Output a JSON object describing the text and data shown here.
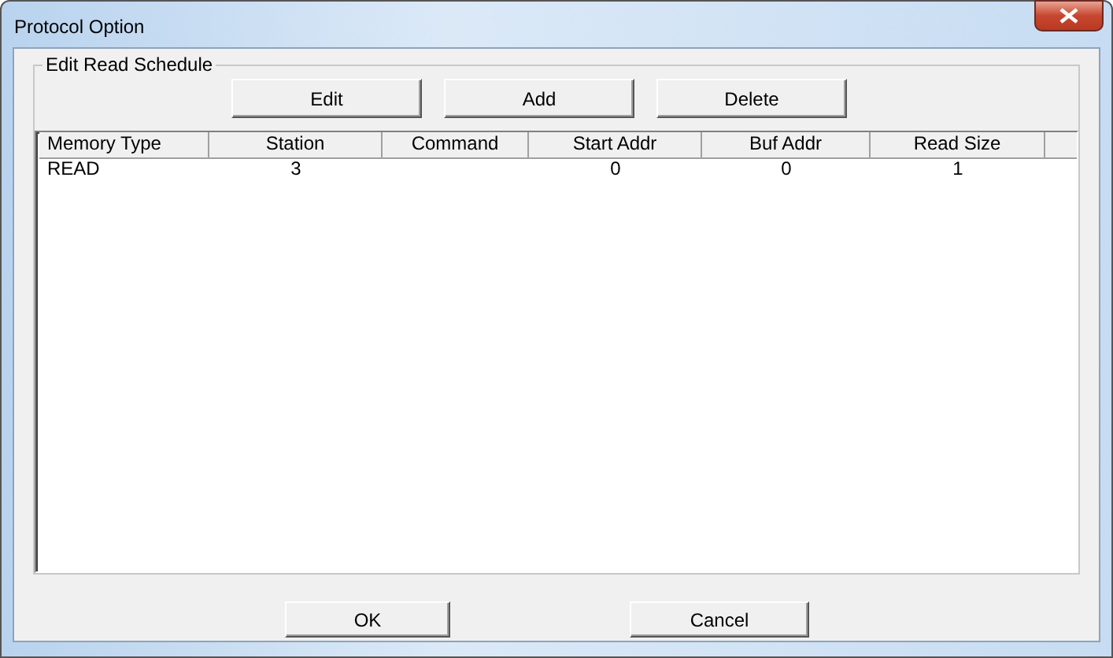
{
  "window": {
    "title": "Protocol Option"
  },
  "group": {
    "title": "Edit Read Schedule"
  },
  "toolbar_buttons": [
    "Edit",
    "Add",
    "Delete"
  ],
  "table": {
    "columns": [
      "Memory Type",
      "Station",
      "Command",
      "Start Addr",
      "Buf Addr",
      "Read Size"
    ],
    "rows": [
      [
        "READ",
        "3",
        null,
        "0",
        "0",
        "1"
      ]
    ]
  },
  "buttons": [
    "OK",
    "Cancel"
  ]
}
